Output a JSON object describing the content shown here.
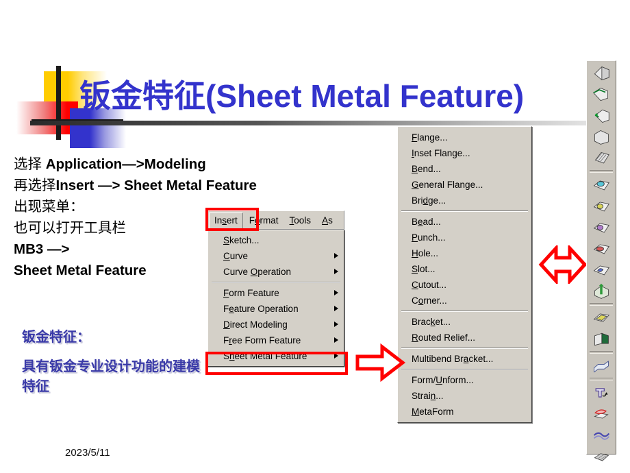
{
  "slide": {
    "title": "钣金特征(Sheet Metal Feature)",
    "title_color": "#3333CC",
    "date": "2023/5/11"
  },
  "body_lines": [
    {
      "cn": "选择 ",
      "en": "Application—>Modeling"
    },
    {
      "cn": "再选择",
      "en": "Insert —> Sheet Metal Feature"
    },
    {
      "cn": "出现菜单：",
      "en": ""
    },
    {
      "cn": "也可以打开工具栏",
      "en": ""
    },
    {
      "cn": "",
      "en": "MB3 —>"
    },
    {
      "cn": "",
      "en": "Sheet Metal Feature"
    }
  ],
  "callout": {
    "heading": "钣金特征：",
    "text": "具有钣金专业设计功能的建模特征",
    "color": "#3A3AA8"
  },
  "insert_menu": {
    "menubar": [
      {
        "label": "Insert",
        "mnemonic": "s",
        "active": true
      },
      {
        "label": "Format",
        "mnemonic": "o",
        "active": false
      },
      {
        "label": "Tools",
        "mnemonic": "T",
        "active": false
      },
      {
        "label": "As",
        "mnemonic": "A",
        "active": false
      }
    ],
    "items": [
      {
        "label": "Sketch...",
        "mnemonic": "S",
        "submenu": false
      },
      {
        "label": "Curve",
        "mnemonic": "C",
        "submenu": true
      },
      {
        "label": "Curve Operation",
        "mnemonic": "O",
        "submenu": true
      },
      {
        "separator": true
      },
      {
        "label": "Form Feature",
        "mnemonic": "F",
        "submenu": true
      },
      {
        "label": "Feature Operation",
        "mnemonic": "e",
        "submenu": true
      },
      {
        "label": "Direct Modeling",
        "mnemonic": "D",
        "submenu": true
      },
      {
        "label": "Free Form Feature",
        "mnemonic": "r",
        "submenu": true
      },
      {
        "label": "Sheet Metal Feature",
        "mnemonic": "h",
        "submenu": true,
        "highlighted": true
      }
    ]
  },
  "sheet_metal_menu": {
    "items": [
      {
        "label": "Flange...",
        "mnemonic": "F"
      },
      {
        "label": "Inset Flange...",
        "mnemonic": "I"
      },
      {
        "label": "Bend...",
        "mnemonic": "B"
      },
      {
        "label": "General Flange...",
        "mnemonic": "G"
      },
      {
        "label": "Bridge...",
        "mnemonic": "d"
      },
      {
        "separator": true
      },
      {
        "label": "Bead...",
        "mnemonic": "e"
      },
      {
        "label": "Punch...",
        "mnemonic": "P"
      },
      {
        "label": "Hole...",
        "mnemonic": "H"
      },
      {
        "label": "Slot...",
        "mnemonic": "S"
      },
      {
        "label": "Cutout...",
        "mnemonic": "C"
      },
      {
        "label": "Corner...",
        "mnemonic": "o"
      },
      {
        "separator": true
      },
      {
        "label": "Bracket...",
        "mnemonic": "k"
      },
      {
        "label": "Routed Relief...",
        "mnemonic": "R"
      },
      {
        "separator": true
      },
      {
        "label": "Multibend Bracket...",
        "mnemonic": "a"
      },
      {
        "separator": true
      },
      {
        "label": "Form/Unform...",
        "mnemonic": "U"
      },
      {
        "label": "Strain...",
        "mnemonic": "n"
      },
      {
        "label": "MetaForm",
        "mnemonic": "M"
      }
    ]
  },
  "toolbar": {
    "buttons": [
      {
        "name": "flange-tool",
        "tip": "Flange"
      },
      {
        "name": "inset-flange-tool",
        "tip": "Inset Flange"
      },
      {
        "name": "bend-tool",
        "tip": "Bend"
      },
      {
        "name": "general-flange-tool",
        "tip": "General Flange"
      },
      {
        "name": "bridge-tool",
        "tip": "Bridge"
      },
      {
        "separator": true
      },
      {
        "name": "bead-tool",
        "tip": "Bead"
      },
      {
        "name": "punch-tool",
        "tip": "Punch"
      },
      {
        "name": "hole-tool",
        "tip": "Hole"
      },
      {
        "name": "slot-tool",
        "tip": "Slot"
      },
      {
        "name": "cutout-tool",
        "tip": "Cutout"
      },
      {
        "name": "corner-tool",
        "tip": "Corner"
      },
      {
        "separator": true
      },
      {
        "name": "bracket-tool",
        "tip": "Bracket"
      },
      {
        "name": "routed-relief-tool",
        "tip": "Routed Relief"
      },
      {
        "separator": true
      },
      {
        "name": "multibend-bracket-tool",
        "tip": "Multibend Bracket"
      },
      {
        "separator": true
      },
      {
        "name": "form-unform-tool",
        "tip": "Form/Unform"
      },
      {
        "name": "strain-tool",
        "tip": "Strain"
      },
      {
        "name": "metaform-tool",
        "tip": "MetaForm"
      },
      {
        "name": "flat-pattern-tool",
        "tip": "Flat Pattern"
      }
    ]
  },
  "annotations": {
    "arrow_color": "#FF0000",
    "highlight_color": "#FF0000"
  }
}
